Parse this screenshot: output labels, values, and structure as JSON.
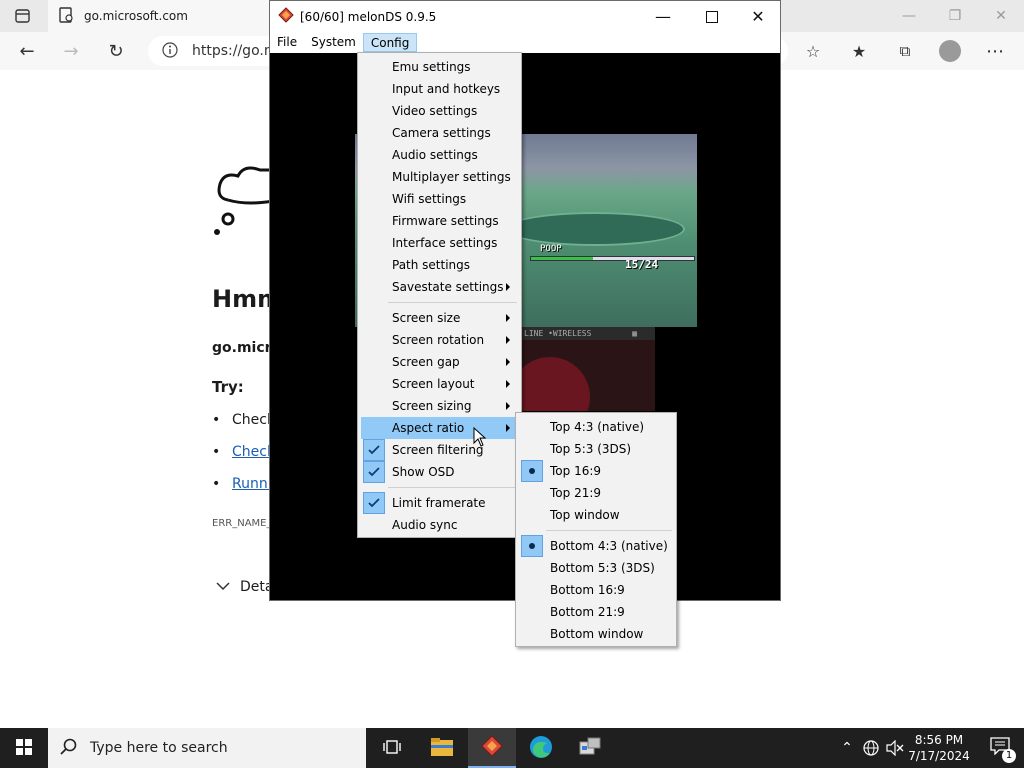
{
  "browser": {
    "tab_title": "go.microsoft.com",
    "address": "https://go.mi",
    "error": {
      "title": "Hmm",
      "host": "go.micro",
      "try_label": "Try:",
      "items": [
        "Check",
        "Check",
        "Runni"
      ],
      "code": "ERR_NAME_",
      "details": "Deta"
    }
  },
  "melon": {
    "title": "[60/60] melonDS 0.9.5",
    "menus": [
      "File",
      "System",
      "Config"
    ],
    "open_menu": "Config",
    "hud": {
      "name": "POOP",
      "hp": "15/24",
      "status_text": "LINE •WIRELESS"
    }
  },
  "config_menu": {
    "groups": [
      [
        {
          "label": "Emu settings"
        },
        {
          "label": "Input and hotkeys"
        },
        {
          "label": "Video settings"
        },
        {
          "label": "Camera settings"
        },
        {
          "label": "Audio settings"
        },
        {
          "label": "Multiplayer settings"
        },
        {
          "label": "Wifi settings"
        },
        {
          "label": "Firmware settings"
        },
        {
          "label": "Interface settings"
        },
        {
          "label": "Path settings"
        },
        {
          "label": "Savestate settings",
          "submenu": true
        }
      ],
      [
        {
          "label": "Screen size",
          "submenu": true
        },
        {
          "label": "Screen rotation",
          "submenu": true
        },
        {
          "label": "Screen gap",
          "submenu": true
        },
        {
          "label": "Screen layout",
          "submenu": true
        },
        {
          "label": "Screen sizing",
          "submenu": true
        },
        {
          "label": "Aspect ratio",
          "submenu": true,
          "highlighted": true
        },
        {
          "label": "Screen filtering",
          "checked": true
        },
        {
          "label": "Show OSD",
          "checked": true
        }
      ],
      [
        {
          "label": "Limit framerate",
          "checked": true
        },
        {
          "label": "Audio sync"
        }
      ]
    ]
  },
  "aspect_menu": {
    "groups": [
      [
        {
          "label": "Top 4:3 (native)"
        },
        {
          "label": "Top 5:3 (3DS)"
        },
        {
          "label": "Top 16:9",
          "selected": true
        },
        {
          "label": "Top 21:9"
        },
        {
          "label": "Top window"
        }
      ],
      [
        {
          "label": "Bottom 4:3 (native)",
          "selected": true
        },
        {
          "label": "Bottom 5:3 (3DS)"
        },
        {
          "label": "Bottom 16:9"
        },
        {
          "label": "Bottom 21:9"
        },
        {
          "label": "Bottom window"
        }
      ]
    ]
  },
  "taskbar": {
    "search_placeholder": "Type here to search",
    "time": "8:56 PM",
    "date": "7/17/2024",
    "notification_count": "1"
  },
  "colors": {
    "menu_highlight": "#91c9f7",
    "taskbar_bg": "#1f1f1f",
    "melon_accent": "#d94a3a"
  }
}
